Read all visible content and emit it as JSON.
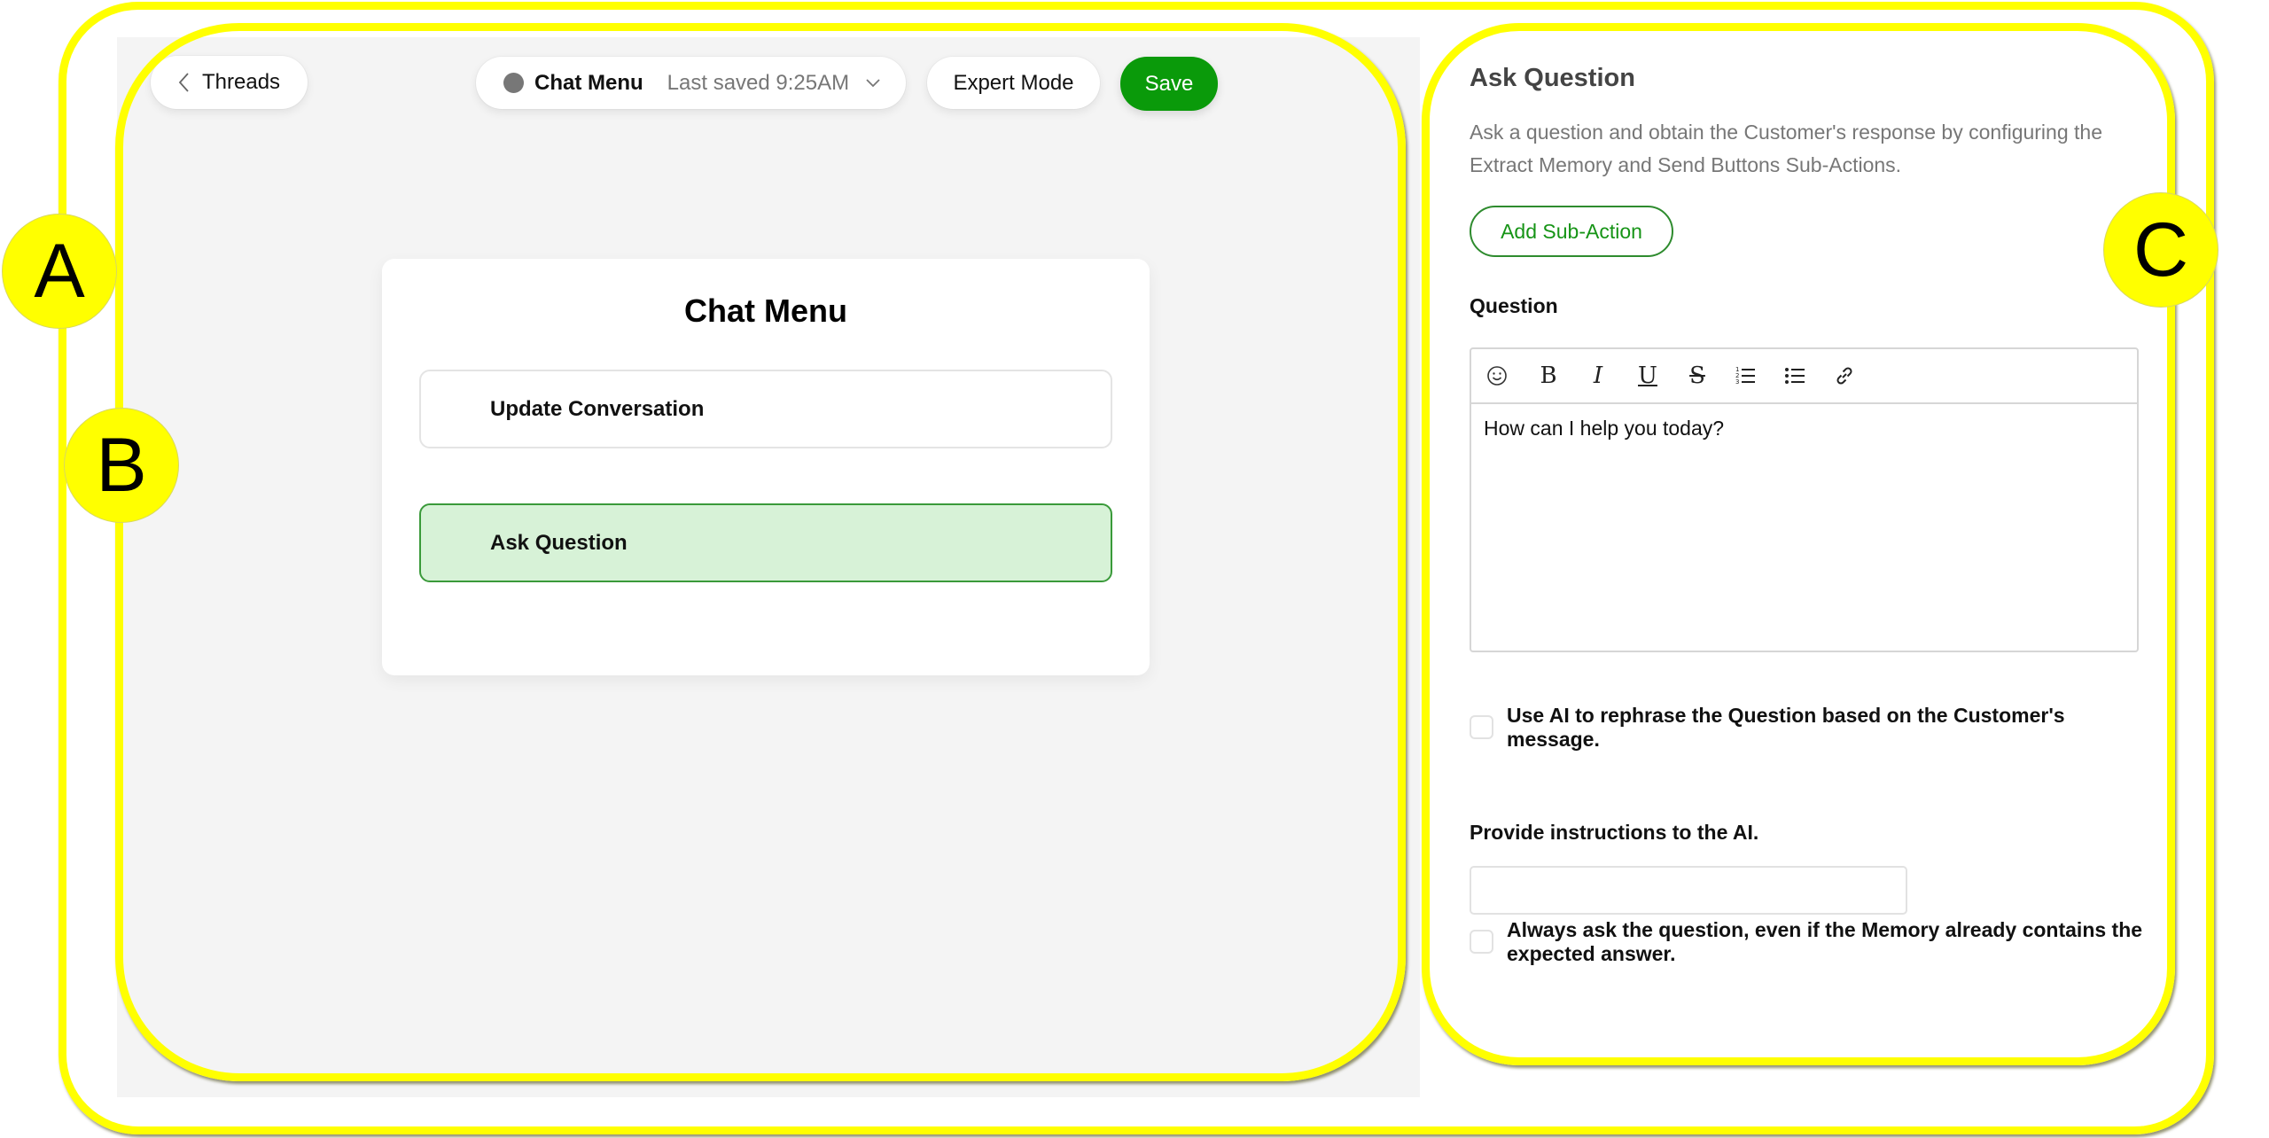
{
  "topbar": {
    "back_label": "Threads",
    "flow_name": "Chat Menu",
    "last_saved": "Last saved 9:25AM",
    "status_dot_color": "#777777",
    "expert_mode_label": "Expert Mode",
    "save_label": "Save",
    "save_color": "#0a9a0a"
  },
  "canvas": {
    "card_title": "Chat Menu",
    "items": [
      {
        "label": "Update Conversation",
        "selected": false
      },
      {
        "label": "Ask Question",
        "selected": true
      }
    ],
    "selected_fill": "#d7f2d7",
    "selected_border": "#3a9a3a"
  },
  "panel": {
    "title": "Ask Question",
    "description": "Ask a question and obtain the Customer's response by configuring the Extract Memory and Send Buttons Sub-Actions.",
    "add_sub_action_label": "Add Sub-Action",
    "question_label": "Question",
    "toolbar": [
      {
        "icon": "emoji-icon",
        "glyph": "☺"
      },
      {
        "icon": "bold-icon",
        "glyph": "B"
      },
      {
        "icon": "italic-icon",
        "glyph": "I"
      },
      {
        "icon": "underline-icon",
        "glyph": "U"
      },
      {
        "icon": "strikethrough-icon",
        "glyph": "S"
      },
      {
        "icon": "ordered-list-icon",
        "glyph": "ordered"
      },
      {
        "icon": "bullet-list-icon",
        "glyph": "bullet"
      },
      {
        "icon": "link-icon",
        "glyph": "link"
      }
    ],
    "question_text": "How can I help you today?",
    "rephrase_checkbox": {
      "label": "Use AI to rephrase the Question based on the Customer's message.",
      "checked": false
    },
    "ai_instructions_label": "Provide instructions to the AI.",
    "ai_instructions_value": "",
    "always_ask_checkbox": {
      "label": "Always ask the question, even if the Memory already contains the expected answer.",
      "checked": false
    }
  },
  "annotations": {
    "labels": [
      "A",
      "B",
      "C"
    ],
    "color": "#ffff00"
  }
}
